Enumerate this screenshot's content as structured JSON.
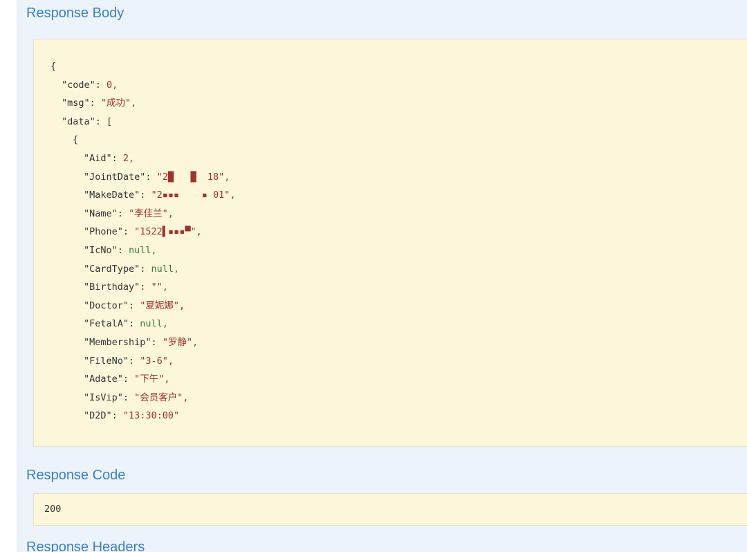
{
  "response_body": {
    "title": "Response Body",
    "lines": [
      {
        "indent": 0,
        "text": "{"
      },
      {
        "indent": 1,
        "key": "\"code\"",
        "value": "0,",
        "vtype": "n"
      },
      {
        "indent": 1,
        "key": "\"msg\"",
        "value": "\"成功\",",
        "vtype": "s"
      },
      {
        "indent": 1,
        "key": "\"data\"",
        "value": "[",
        "vtype": "p"
      },
      {
        "indent": 2,
        "text": "{"
      },
      {
        "indent": 3,
        "key": "\"Aid\"",
        "value": "2,",
        "vtype": "n"
      },
      {
        "indent": 3,
        "key": "\"JointDate\"",
        "value": "\"2█   █  18\",",
        "vtype": "s"
      },
      {
        "indent": 3,
        "key": "\"MakeDate\"",
        "value": "\"2▪▪▪    ▪ 01\",",
        "vtype": "s"
      },
      {
        "indent": 3,
        "key": "\"Name\"",
        "value": "\"李佳兰\",",
        "vtype": "s"
      },
      {
        "indent": 3,
        "key": "\"Phone\"",
        "value": "\"1522▌▪▪▪▀\",",
        "vtype": "s"
      },
      {
        "indent": 3,
        "key": "\"IcNo\"",
        "value": "null,",
        "vtype": "nl"
      },
      {
        "indent": 3,
        "key": "\"CardType\"",
        "value": "null,",
        "vtype": "nl"
      },
      {
        "indent": 3,
        "key": "\"Birthday\"",
        "value": "\"\",",
        "vtype": "s"
      },
      {
        "indent": 3,
        "key": "\"Doctor\"",
        "value": "\"夏妮娜\",",
        "vtype": "s"
      },
      {
        "indent": 3,
        "key": "\"FetalA\"",
        "value": "null,",
        "vtype": "nl"
      },
      {
        "indent": 3,
        "key": "\"Membership\"",
        "value": "\"罗静\",",
        "vtype": "s"
      },
      {
        "indent": 3,
        "key": "\"FileNo\"",
        "value": "\"3-6\",",
        "vtype": "s"
      },
      {
        "indent": 3,
        "key": "\"Adate\"",
        "value": "\"下午\",",
        "vtype": "s"
      },
      {
        "indent": 3,
        "key": "\"IsVip\"",
        "value": "\"会员客户\",",
        "vtype": "s"
      },
      {
        "indent": 3,
        "key": "\"D2D\"",
        "value": "\"13:30:00\"",
        "vtype": "s"
      }
    ]
  },
  "response_code": {
    "title": "Response Code",
    "value": "200"
  },
  "response_headers": {
    "title": "Response Headers"
  },
  "colors": {
    "panel_bg": "#ecf3fa",
    "code_bg": "#fcf6db",
    "title": "#3b80c1",
    "string": "#a0312b",
    "null": "#3a7d3a"
  }
}
